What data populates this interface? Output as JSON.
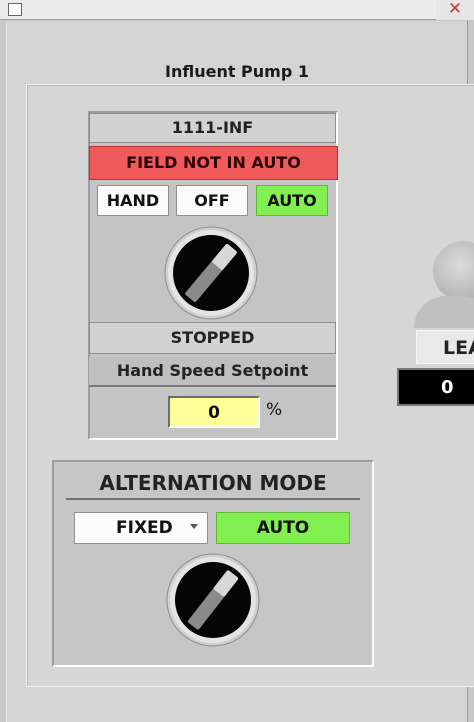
{
  "window": {
    "close_glyph": "✕"
  },
  "title": "Influent Pump 1",
  "pump": {
    "tag": "1111-INF",
    "alarm_text": "FIELD NOT IN AUTO",
    "mode_buttons": {
      "hand": "HAND",
      "off": "OFF",
      "auto": "AUTO",
      "active": "auto"
    },
    "status": "STOPPED",
    "setpoint_label": "Hand Speed Setpoint",
    "setpoint_value": "0",
    "setpoint_unit": "%"
  },
  "alternation": {
    "title": "ALTERNATION MODE",
    "selected_option": "FIXED",
    "status": "AUTO"
  },
  "lead": {
    "label": "LEA",
    "value": "0"
  },
  "colors": {
    "alarm_red": "#f15a5a",
    "active_green": "#82f050",
    "setpoint_yellow": "#ffff99"
  }
}
